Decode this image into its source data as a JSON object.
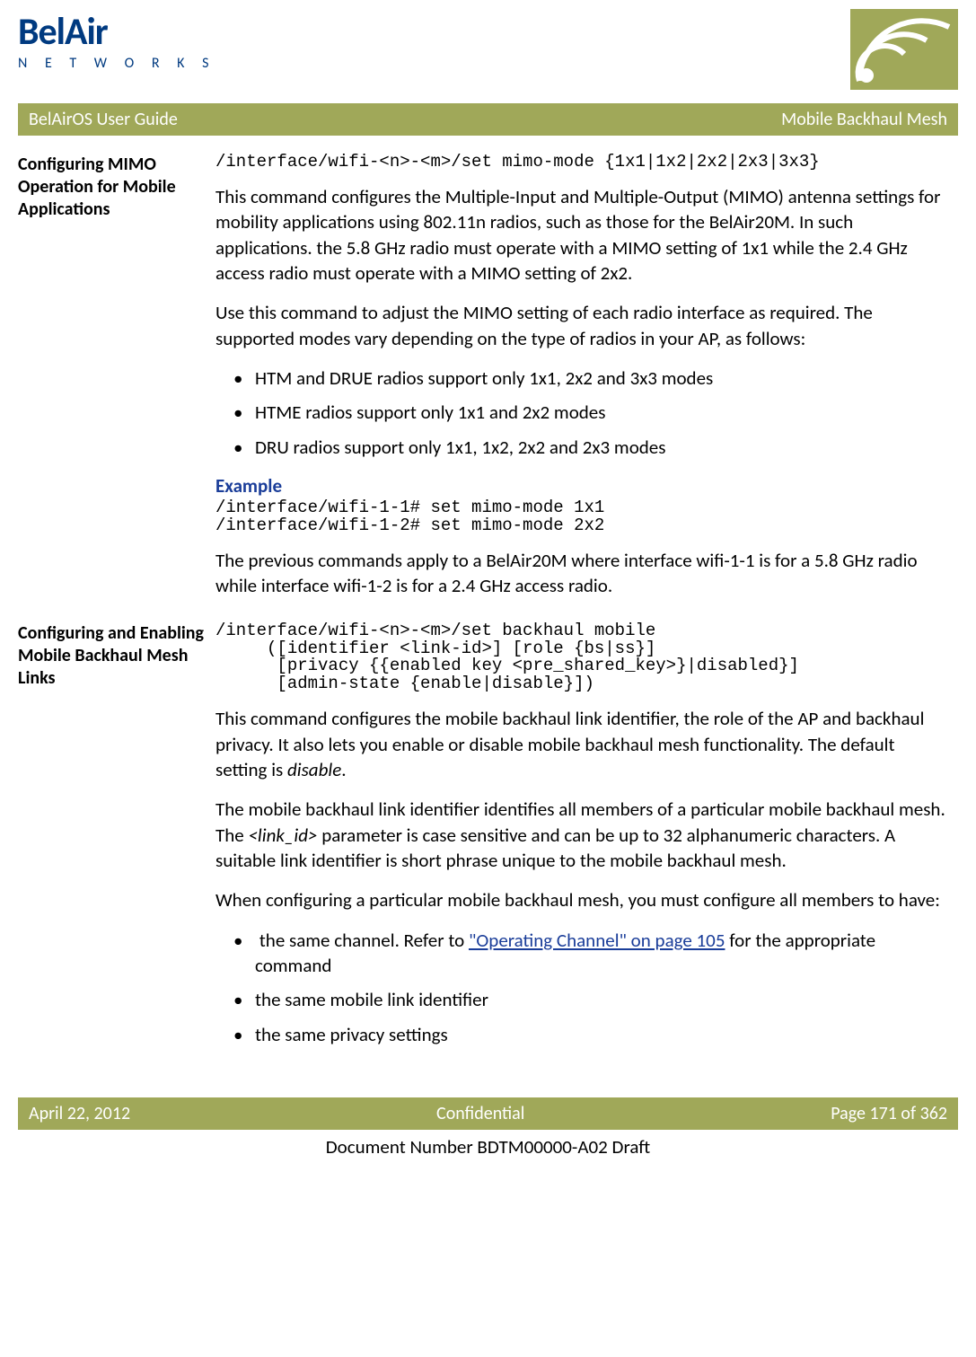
{
  "header": {
    "logo_main": "BelAir",
    "logo_sub": "N E T W O R K S"
  },
  "titlebar": {
    "left": "BelAirOS User Guide",
    "right": "Mobile Backhaul Mesh"
  },
  "section1": {
    "heading": "Configuring MIMO Operation for Mobile Applications",
    "cmd": "/interface/wifi-<n>-<m>/set mimo-mode {1x1|1x2|2x2|2x3|3x3}",
    "p1": "This command configures the Multiple-Input and Multiple-Output (MIMO) antenna settings for mobility applications using 802.11n radios, such as those for the BelAir20M. In such applications. the 5.8 GHz radio must operate with a MIMO setting of 1x1 while the 2.4 GHz access radio must operate with a MIMO setting of 2x2.",
    "p2": "Use this command to adjust the MIMO setting of each radio interface as required. The supported modes vary depending on the type of radios in your AP, as follows:",
    "bullets": [
      "HTM and DRUE radios support only 1x1, 2x2 and 3x3 modes",
      "HTME radios support only 1x1 and 2x2 modes",
      "DRU radios support only 1x1, 1x2, 2x2 and 2x3 modes"
    ],
    "example_h": "Example",
    "example_code": "/interface/wifi-1-1# set mimo-mode 1x1\n/interface/wifi-1-2# set mimo-mode 2x2",
    "p3": "The previous commands apply to a BelAir20M where interface wifi-1-1 is for a 5.8 GHz radio while interface wifi-1-2 is for a 2.4 GHz access radio."
  },
  "section2": {
    "heading": "Configuring and Enabling Mobile Backhaul Mesh Links",
    "cmd": "/interface/wifi-<n>-<m>/set backhaul mobile\n     ([identifier <link-id>] [role {bs|ss}]\n      [privacy {{enabled key <pre_shared_key>}|disabled}]\n      [admin-state {enable|disable}])",
    "p1a": "This command configures the mobile backhaul link identifier, the role of the AP and backhaul privacy. It also lets you enable or disable mobile backhaul mesh functionality. The default setting is ",
    "p1b": "disable",
    "p1c": ".",
    "p2a": "The mobile backhaul link identifier identifies all members of a particular mobile backhaul mesh. The ",
    "p2b": "<link_id>",
    "p2c": " parameter is case sensitive and can be up to 32 alphanumeric characters. A suitable link identifier is short phrase unique to the mobile backhaul mesh.",
    "p3": "When configuring a particular mobile backhaul mesh, you must configure all members to have:",
    "bullets": {
      "b1a": "the same channel. Refer to ",
      "b1link": "\"Operating Channel\" on page 105",
      "b1b": " for the appropriate command",
      "b2": "the same mobile link identifier",
      "b3": "the same privacy settings"
    }
  },
  "footer": {
    "left": "April 22, 2012",
    "center": "Confidential",
    "right": "Page 171 of 362",
    "docnum": "Document Number BDTM00000-A02 Draft"
  }
}
